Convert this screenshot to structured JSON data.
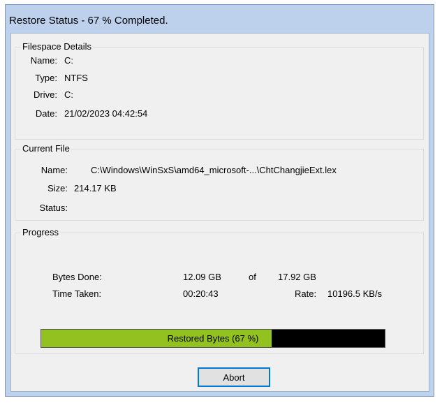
{
  "window": {
    "title": "Restore Status - 67 % Completed."
  },
  "filespace": {
    "legend": "Filespace Details",
    "name_label": "Name:",
    "name_value": "C:",
    "type_label": "Type:",
    "type_value": "NTFS",
    "drive_label": "Drive:",
    "drive_value": "C:",
    "date_label": "Date:",
    "date_value": "21/02/2023 04:42:54"
  },
  "current_file": {
    "legend": "Current File",
    "name_label": "Name:",
    "name_value": "C:\\Windows\\WinSxS\\amd64_microsoft-...\\ChtChangjieExt.lex",
    "size_label": "Size:",
    "size_value": "214.17 KB",
    "status_label": "Status:",
    "status_value": ""
  },
  "progress": {
    "legend": "Progress",
    "bytes_done_label": "Bytes Done:",
    "bytes_done_value": "12.09 GB",
    "of_label": "of",
    "bytes_total_value": "17.92 GB",
    "time_taken_label": "Time Taken:",
    "time_taken_value": "00:20:43",
    "rate_label": "Rate:",
    "rate_value": "10196.5 KB/s",
    "bar_text": "Restored Bytes (67 %)",
    "bar_fraction": 0.67,
    "bar_fill_color": "#93c11f",
    "bar_track_color": "#000000"
  },
  "buttons": {
    "abort_label": "Abort"
  }
}
